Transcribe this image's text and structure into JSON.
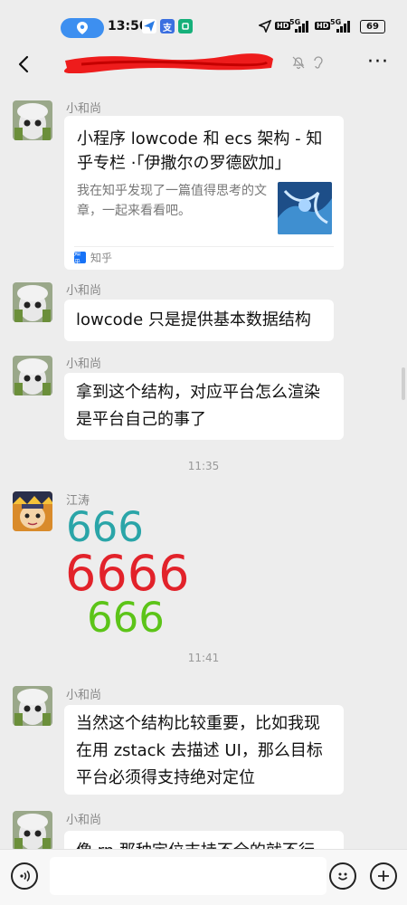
{
  "status_bar": {
    "time": "13:50",
    "net1": "HD",
    "net1_type": "5G",
    "net2": "HD",
    "net2_type": "5G",
    "battery": "69"
  },
  "header": {
    "back_icon": "chevron-left-icon",
    "more_label": "···"
  },
  "messages": [
    {
      "sender": "小和尚",
      "card": {
        "title": "小程序 lowcode 和 ecs 架构 - 知乎专栏 ·「伊撒尔の罗德欧加」",
        "description": "我在知乎发现了一篇值得思考的文章，一起来看看吧。",
        "source": "知乎",
        "source_logo": "知乎"
      }
    },
    {
      "sender": "小和尚",
      "text": "lowcode 只是提供基本数据结构"
    },
    {
      "sender": "小和尚",
      "text": "拿到这个结构，对应平台怎么渲染是平台自己的事了"
    },
    {
      "timestamp": "11:35"
    },
    {
      "sender": "江涛",
      "emoji_lines": [
        "666",
        "6666",
        "666"
      ]
    },
    {
      "timestamp": "11:41"
    },
    {
      "sender": "小和尚",
      "text": "当然这个结构比较重要，比如我现在用 zstack 去描述 UI，那么目标平台必须得支持绝对定位"
    },
    {
      "sender": "小和尚",
      "text": "像 rn 那种定位支持不全的就不行"
    }
  ],
  "colors": {
    "num_teal": "#2aa5a8",
    "num_red": "#e2222a",
    "num_green": "#5cc418",
    "accent_blue": "#3d8ff0"
  },
  "input_bar": {
    "voice_icon": "voice-icon",
    "emoji_icon": "emoji-icon",
    "plus_icon": "plus-icon",
    "value": ""
  }
}
